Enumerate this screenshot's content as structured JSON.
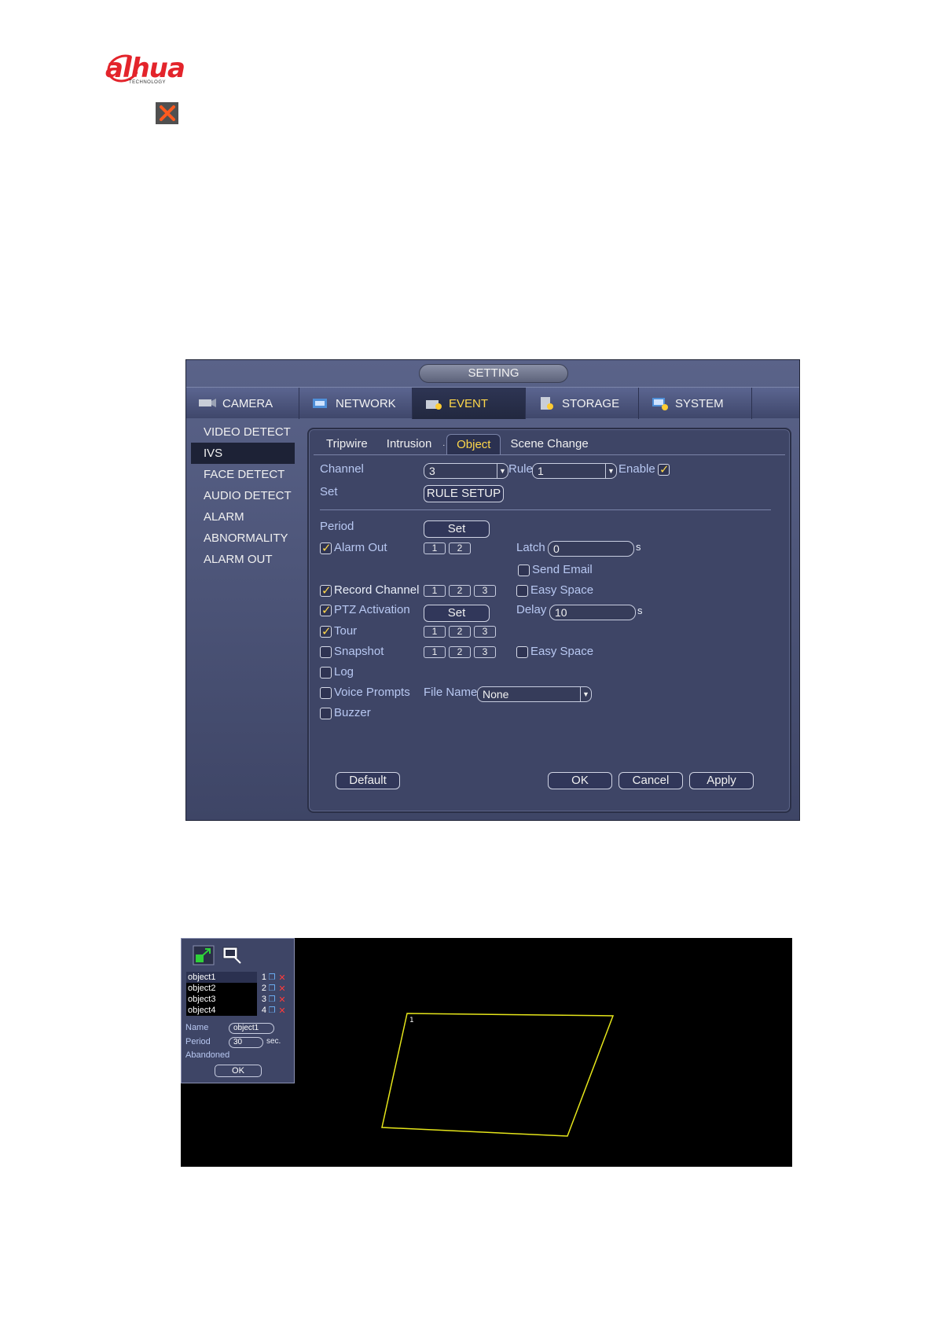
{
  "logo": {
    "word": "alhua",
    "sub": "TECHNOLOGY"
  },
  "colors": {
    "accent": "#ffd84a",
    "label": "#b8c8f2",
    "panel": "#3e4566",
    "logo_red": "#e3242b",
    "rule_line": "#e5e51a"
  },
  "setting": {
    "title": "SETTING",
    "topnav": [
      {
        "label": "CAMERA",
        "icon": "camera-icon"
      },
      {
        "label": "NETWORK",
        "icon": "network-icon"
      },
      {
        "label": "EVENT",
        "icon": "event-icon"
      },
      {
        "label": "STORAGE",
        "icon": "storage-icon"
      },
      {
        "label": "SYSTEM",
        "icon": "system-icon"
      }
    ],
    "menu": [
      "VIDEO DETECT",
      "IVS",
      "FACE DETECT",
      "AUDIO DETECT",
      "ALARM",
      "ABNORMALITY",
      "ALARM OUT"
    ],
    "subtabs": [
      "Tripwire",
      "Intrusion",
      "Object",
      "Scene Change"
    ],
    "subtab_dot": ".",
    "channel": {
      "label": "Channel",
      "value": "3"
    },
    "rule": {
      "label": "Rule",
      "value": "1"
    },
    "enable": {
      "label": "Enable",
      "checked": true
    },
    "set_row": {
      "label": "Set",
      "button": "RULE SETUP"
    },
    "period": {
      "label": "Period",
      "button": "Set"
    },
    "alarm_out": {
      "label": "Alarm Out",
      "checked": true,
      "channels": [
        "1",
        "2"
      ]
    },
    "latch": {
      "label": "Latch",
      "value": "0",
      "unit": "s"
    },
    "send_email": {
      "label": "Send Email",
      "checked": false
    },
    "record_channel": {
      "label": "Record Channel",
      "checked": true,
      "channels": [
        "1",
        "2",
        "3"
      ]
    },
    "easy_space_1": {
      "label": "Easy Space",
      "checked": false
    },
    "ptz": {
      "label": "PTZ Activation",
      "checked": true,
      "button": "Set"
    },
    "delay": {
      "label": "Delay",
      "value": "10",
      "unit": "s"
    },
    "tour": {
      "label": "Tour",
      "checked": true,
      "channels": [
        "1",
        "2",
        "3"
      ]
    },
    "snapshot": {
      "label": "Snapshot",
      "checked": false,
      "channels": [
        "1",
        "2",
        "3"
      ]
    },
    "easy_space_2": {
      "label": "Easy Space",
      "checked": false
    },
    "log": {
      "label": "Log",
      "checked": false
    },
    "voice": {
      "label": "Voice Prompts",
      "checked": false
    },
    "file_name": {
      "label": "File Name",
      "value": "None"
    },
    "buzzer": {
      "label": "Buzzer",
      "checked": false
    },
    "buttons": {
      "default": "Default",
      "ok": "OK",
      "cancel": "Cancel",
      "apply": "Apply"
    }
  },
  "rule_panel": {
    "objects": [
      {
        "name": "object1",
        "num": "1"
      },
      {
        "name": "object2",
        "num": "2"
      },
      {
        "name": "object3",
        "num": "3"
      },
      {
        "name": "object4",
        "num": "4"
      }
    ],
    "name": {
      "label": "Name",
      "value": "object1"
    },
    "period": {
      "label": "Period",
      "value": "30",
      "unit": "sec."
    },
    "abandoned_label": "Abandoned",
    "ok": "OK",
    "region_label": "1"
  }
}
